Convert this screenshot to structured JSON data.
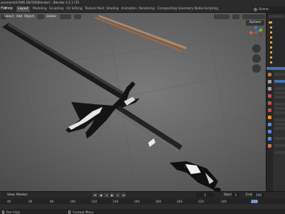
{
  "window": {
    "title": "ocuments\\CAME DSCDS\\Blender] - Blender 4.2.1 LTS"
  },
  "menubar": {
    "file": "File",
    "edit": "Edit",
    "help": "Help"
  },
  "workspaces": [
    "Layout",
    "Modeling",
    "Sculpting",
    "UV Editing",
    "Texture Paint",
    "Shading",
    "Animation",
    "Rendering",
    "Compositing",
    "Geometry Nodes",
    "Scripting"
  ],
  "scene": {
    "name": "Scene"
  },
  "viewport": {
    "select": "Select",
    "add": "Add",
    "object": "Object",
    "orientation": "Global",
    "options": "Options"
  },
  "timeline": {
    "view": "View",
    "marker": "Marker",
    "current_frame": "1",
    "start_label": "Start",
    "start": "1",
    "end_label": "End",
    "end": "250",
    "ruler": [
      "40",
      "60",
      "80",
      "100",
      "120",
      "140",
      "160",
      "180",
      "200",
      "220",
      "240",
      "250"
    ]
  },
  "statusbar": {
    "pan_view": "Pan View",
    "context_menu": "Context Menu"
  },
  "colors": {
    "accent": "#4772b3",
    "header": "#2b2b2b",
    "viewport": "#6a6a6a"
  }
}
